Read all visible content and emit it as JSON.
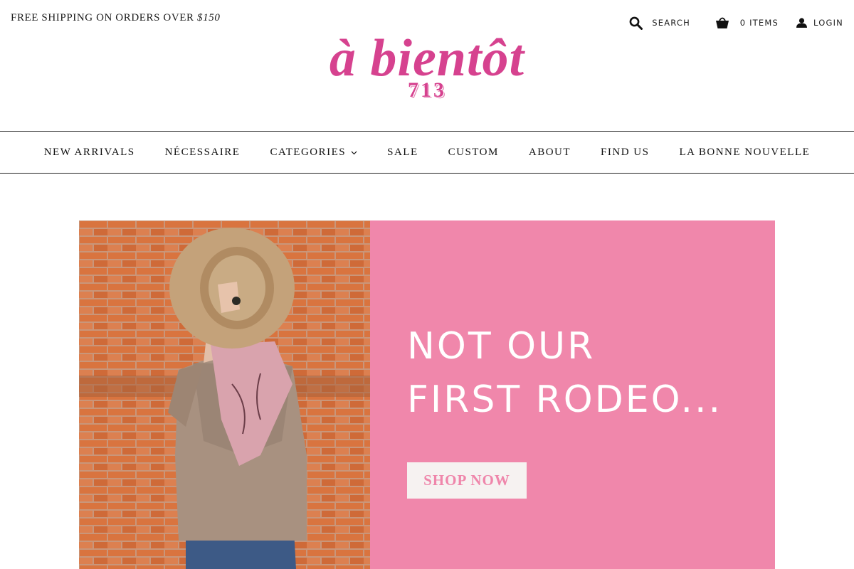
{
  "promo": {
    "text": "FREE SHIPPING ON ORDERS OVER ",
    "amount": "$150"
  },
  "utility": {
    "search_label": "SEARCH",
    "cart_label": "0 ITEMS",
    "login_label": "LOGIN",
    "icons": [
      "search-icon",
      "shopping-basket-icon",
      "user-icon"
    ]
  },
  "logo": {
    "main": "à bientôt",
    "sub": "713"
  },
  "nav": {
    "items": [
      {
        "label": "NEW ARRIVALS"
      },
      {
        "label": "NÉCESSAIRE"
      },
      {
        "label": "CATEGORIES",
        "has_dropdown": true
      },
      {
        "label": "SALE"
      },
      {
        "label": "CUSTOM"
      },
      {
        "label": "ABOUT"
      },
      {
        "label": "FIND US"
      },
      {
        "label": "LA BONNE NOUVELLE"
      }
    ]
  },
  "hero": {
    "headline_line1": "NOT OUR",
    "headline_line2": "FIRST RODEO...",
    "button_label": "SHOP NOW"
  },
  "colors": {
    "brand_pink": "#d6428f",
    "panel_pink": "#f087ab",
    "button_bg": "#f6f2f1",
    "button_text": "#ef86ab"
  }
}
